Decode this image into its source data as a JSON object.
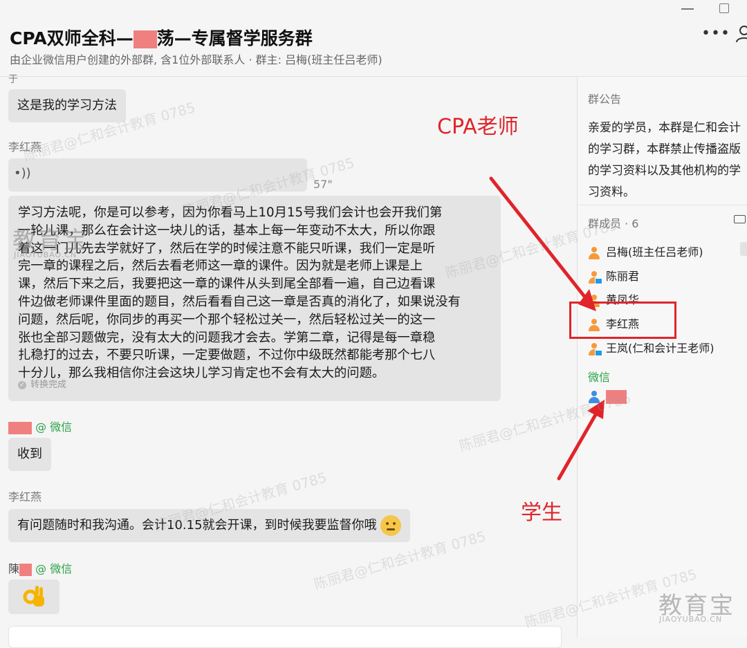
{
  "header": {
    "title_prefix": "CPA双师全科—",
    "title_mid": "—",
    "title_suffix": "—专属督学服务群",
    "subtitle": "由企业微信用户创建的外部群, 含1位外部联系人 · 群主: 吕梅(班主任吕老师)"
  },
  "chat": {
    "messages": [
      {
        "type": "text",
        "text": "这是我的学习方法"
      },
      {
        "type": "sender",
        "name": "李红燕"
      },
      {
        "type": "voice",
        "duration": "57\""
      },
      {
        "type": "transcript",
        "lines": [
          "学习方法呢，你是可以参考，因为你看马上10月15号我们会计也会开我们第",
          "一轮儿课，那么在会计这一块儿的话，基本上每一年变动不太大，所以你跟",
          "着这一门儿先去学就好了，然后在学的时候注意不能只听课，我们一定是听",
          "完一章的课程之后，然后去看老师这一章的课件。因为就是老师上课是上",
          "课，然后下来之后，我要把这一章的课件从头到尾全部看一遍，自己边看课",
          "件边做老师课件里面的题目，然后看看自己这一章是否真的消化了，如果说没有",
          "问题，然后呢，你同步的再买一个那个轻松过关一，然后轻松过关一的这一",
          "张也全部习题做完，没有太大的问题我才会去。学第二章，记得是每一章稳",
          "扎稳打的过去，不要只听课，一定要做题，不过你中级既然都能考那个七八",
          "十分儿，那么我相信你注会这块儿学习肯定也不会有太大的问题。"
        ],
        "status": "转换完成"
      },
      {
        "type": "sender",
        "name_suffix": "@ 微信"
      },
      {
        "type": "text",
        "text": "收到"
      },
      {
        "type": "sender",
        "name": "李红燕"
      },
      {
        "type": "text",
        "text": "有问题随时和我沟通。会计10.15就会开课，到时候我要监督你哦"
      },
      {
        "type": "sender",
        "name_prefix": "陳",
        "name_suffix": "@ 微信"
      }
    ]
  },
  "annotations": {
    "teacher_label": "CPA老师",
    "student_label": "学生",
    "color": "#e0242a"
  },
  "sidebar": {
    "notice_title": "群公告",
    "notice_lines": [
      "亲爱的学员，本群是仁和会计",
      "的学习群，本群禁止传播盗版",
      "的学习资料以及其他机构的学",
      "习资料。"
    ],
    "members_title": "群成员 · 6",
    "members": [
      {
        "name": "吕梅(班主任吕老师)",
        "icon": "person-orange-icon"
      },
      {
        "name": "陈丽君",
        "icon": "person-pc-icon"
      },
      {
        "name": "黄凤华",
        "icon": "person-orange-icon"
      },
      {
        "name": "李红燕",
        "icon": "person-orange-icon"
      },
      {
        "name": "王岚(仁和会计王老师)",
        "icon": "person-pc-icon"
      }
    ],
    "wechat_group_label": "微信"
  },
  "watermarks": {
    "text_a": "陈丽君@仁和会计教育 0785",
    "logo_text": "教育宝",
    "logo_sub": "JIAOYUBAO.CN"
  },
  "colors": {
    "person_orange": "#f59a3c",
    "person_blue": "#3d8ee0",
    "wechat_green": "#2aa246",
    "redact_pink": "#f08080"
  }
}
